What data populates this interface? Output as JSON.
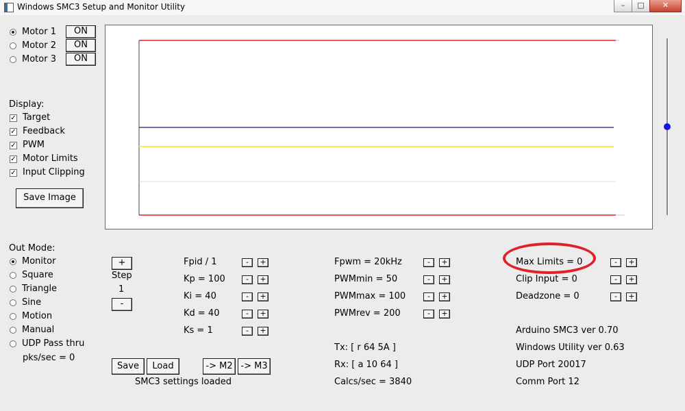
{
  "window": {
    "title": "Windows SMC3 Setup and Monitor Utility",
    "minimize": "–",
    "maximize": "□",
    "close": "✕"
  },
  "motors": [
    {
      "label": "Motor 1",
      "selected": true,
      "button": "ON"
    },
    {
      "label": "Motor 2",
      "selected": false,
      "button": "ON"
    },
    {
      "label": "Motor 3",
      "selected": false,
      "button": "ON"
    }
  ],
  "display": {
    "heading": "Display:",
    "options": [
      {
        "label": "Target",
        "checked": true
      },
      {
        "label": "Feedback",
        "checked": true
      },
      {
        "label": "PWM",
        "checked": true
      },
      {
        "label": "Motor Limits",
        "checked": true
      },
      {
        "label": "Input Clipping",
        "checked": true
      }
    ],
    "save_image": "Save Image"
  },
  "out_mode": {
    "heading": "Out Mode:",
    "options": [
      {
        "label": "Monitor",
        "selected": true
      },
      {
        "label": "Square",
        "selected": false
      },
      {
        "label": "Triangle",
        "selected": false
      },
      {
        "label": "Sine",
        "selected": false
      },
      {
        "label": "Motion",
        "selected": false
      },
      {
        "label": "Manual",
        "selected": false
      },
      {
        "label": "UDP Pass thru",
        "selected": false
      }
    ],
    "pks_sec": "pks/sec = 0"
  },
  "step": {
    "plus": "+",
    "label": "Step",
    "value": "1",
    "minus": "-"
  },
  "pid_params": [
    {
      "label": "Fpid / 1"
    },
    {
      "label": "Kp = 100"
    },
    {
      "label": "Ki = 40"
    },
    {
      "label": "Kd = 40"
    },
    {
      "label": "Ks = 1"
    }
  ],
  "pwm_params": [
    {
      "label": "Fpwm = 20kHz"
    },
    {
      "label": "PWMmin = 50"
    },
    {
      "label": "PWMmax = 100"
    },
    {
      "label": "PWMrev = 200"
    }
  ],
  "limit_params": [
    {
      "label": "Max Limits = 0"
    },
    {
      "label": "Clip Input = 0"
    },
    {
      "label": "Deadzone = 0"
    }
  ],
  "stepper": {
    "minus": "-",
    "plus": "+"
  },
  "buttons": {
    "save": "Save",
    "load": "Load",
    "to_m2": "-> M2",
    "to_m3": "-> M3"
  },
  "status": {
    "settings": "SMC3 settings loaded",
    "tx": "Tx: [ r 64 5A ]",
    "rx": "Rx: [ a 10 64 ]",
    "calcs": "Calcs/sec = 3840",
    "arduino_ver": "Arduino SMC3 ver 0.70",
    "utility_ver": "Windows Utility ver 0.63",
    "udp_port": "UDP Port 20017",
    "comm_port": "Comm Port 12"
  },
  "colors": {
    "limit_line": "#e02020",
    "target_line": "#1a1a7a",
    "pwm_line": "#f0f040",
    "feedback_line": "#d8d8d8",
    "highlight_oval": "#e0202a",
    "slider_knob": "#1515e0"
  }
}
